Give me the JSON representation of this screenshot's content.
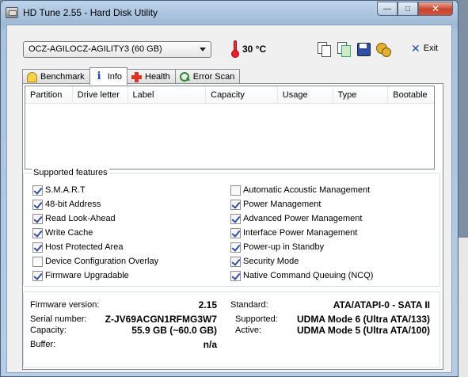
{
  "window": {
    "title": "HD Tune 2.55 - Hard Disk Utility",
    "min_symbol": "—",
    "max_symbol": "□",
    "close_symbol": "✕"
  },
  "toolbar": {
    "drive": "OCZ-AGILOCZ-AGILITY3 (60 GB)",
    "temperature": "30 °C",
    "exit_label": "Exit",
    "exit_symbol": "✕",
    "icons": [
      "copy-text-icon",
      "copy-screenshot-icon",
      "save-icon",
      "options-icon"
    ]
  },
  "tabs": [
    {
      "label": "Benchmark",
      "icon": "benchmark-icon",
      "active": false
    },
    {
      "label": "Info",
      "icon": "info-icon",
      "active": true
    },
    {
      "label": "Health",
      "icon": "health-icon",
      "active": false
    },
    {
      "label": "Error Scan",
      "icon": "error-scan-icon",
      "active": false
    }
  ],
  "info_icon_glyph": "i",
  "partitions": {
    "columns": [
      "Partition",
      "Drive letter",
      "Label",
      "Capacity",
      "Usage",
      "Type",
      "Bootable"
    ],
    "rows": []
  },
  "features": {
    "title": "Supported features",
    "left": [
      {
        "label": "S.M.A.R.T",
        "checked": true
      },
      {
        "label": "48-bit Address",
        "checked": true
      },
      {
        "label": "Read Look-Ahead",
        "checked": true
      },
      {
        "label": "Write Cache",
        "checked": true
      },
      {
        "label": "Host Protected Area",
        "checked": true
      },
      {
        "label": "Device Configuration Overlay",
        "checked": false
      },
      {
        "label": "Firmware Upgradable",
        "checked": true
      }
    ],
    "right": [
      {
        "label": "Automatic Acoustic Management",
        "checked": false
      },
      {
        "label": "Power Management",
        "checked": true
      },
      {
        "label": "Advanced Power Management",
        "checked": true
      },
      {
        "label": "Interface Power Management",
        "checked": true
      },
      {
        "label": "Power-up in Standby",
        "checked": true
      },
      {
        "label": "Security Mode",
        "checked": true
      },
      {
        "label": "Native Command Queuing (NCQ)",
        "checked": true
      }
    ]
  },
  "details": {
    "firmware_label": "Firmware version:",
    "firmware_value": "2.15",
    "serial_label": "Serial number:",
    "serial_value": "Z-JV69ACGN1RFMG3W7",
    "capacity_label": "Capacity:",
    "capacity_value": "55.9 GB (~60.0 GB)",
    "buffer_label": "Buffer:",
    "buffer_value": "n/a",
    "standard_label": "Standard:",
    "standard_value": "ATA/ATAPI-0 - SATA II",
    "supported_label": "Supported:",
    "supported_value": "UDMA Mode 6 (Ultra ATA/133)",
    "active_label": "Active:",
    "active_value": "UDMA Mode 5 (Ultra ATA/100)"
  }
}
